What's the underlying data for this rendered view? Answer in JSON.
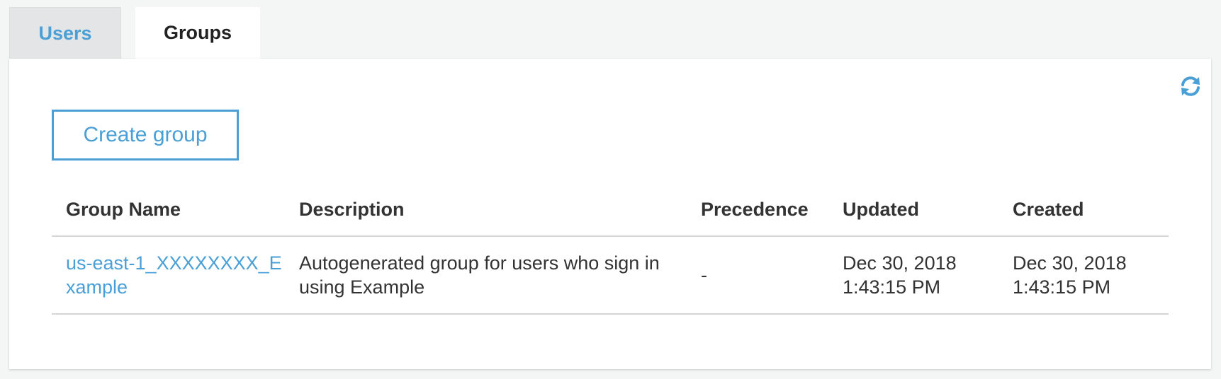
{
  "tabs": {
    "users_label": "Users",
    "groups_label": "Groups"
  },
  "toolbar": {
    "refresh_icon": "refresh-icon",
    "create_group_label": "Create group"
  },
  "table": {
    "columns": [
      "Group Name",
      "Description",
      "Precedence",
      "Updated",
      "Created"
    ],
    "rows": [
      {
        "group_name": "us-east-1_XXXXXXXX_Example",
        "description": "Autogenerated group for users who sign in using Example",
        "precedence": "-",
        "updated": "Dec 30, 2018 1:43:15 PM",
        "created": "Dec 30, 2018 1:43:15 PM"
      }
    ]
  },
  "colors": {
    "accent": "#4a9fd6",
    "text": "#333333",
    "background": "#f4f5f5",
    "panel": "#ffffff"
  }
}
